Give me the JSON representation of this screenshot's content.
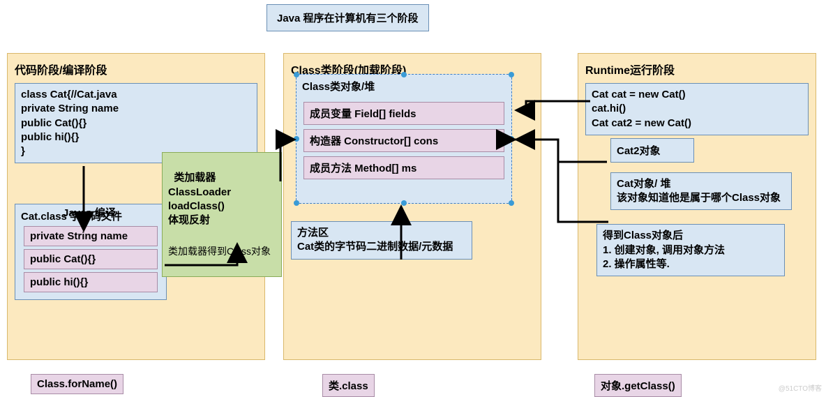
{
  "title": "Java 程序在计算机有三个阶段",
  "stage1": {
    "title": "代码阶段/编译阶段",
    "source": "class Cat{//Cat.java\nprivate String name\npublic Cat(){}\npublic hi(){}\n}",
    "compile_label": "Javac 编译",
    "bytecode_title": "Cat.class 字节码文件",
    "members": [
      "private String name",
      "public Cat(){}",
      "public hi(){}"
    ],
    "footer": "Class.forName()"
  },
  "loader": {
    "text": "类加载器\nClassLoader\nloadClass()\n体现反射",
    "note": "类加载器得到Class对象"
  },
  "stage2": {
    "title": "Class类阶段(加载阶段)",
    "heap_title": "Class类对象/堆",
    "fields": "成员变量 Field[] fields",
    "constructors": "构造器 Constructor[] cons",
    "methods": "成员方法 Method[] ms",
    "method_area": "方法区\nCat类的字节码二进制数据/元数据",
    "footer": "类.class"
  },
  "stage3": {
    "title": "Runtime运行阶段",
    "code": "Cat cat = new Cat()\ncat.hi()\nCat cat2 = new Cat()",
    "cat2_obj": "Cat2对象",
    "cat_obj": "Cat对象/ 堆\n该对象知道他是属于哪个Class对象",
    "after": "得到Class对象后\n1. 创建对象, 调用对象方法\n2. 操作属性等.",
    "footer": "对象.getClass()"
  },
  "watermark": "@51CTO博客"
}
